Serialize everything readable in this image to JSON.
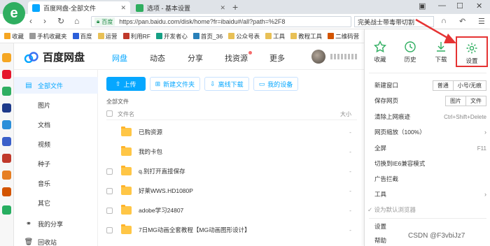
{
  "browser": {
    "logo_letter": "e",
    "tabs": [
      {
        "label": "百度网盘-全部文件",
        "active": true
      },
      {
        "label": "选项 - 基本设置",
        "active": false
      }
    ],
    "new_tab": "+",
    "url": {
      "badge": "百度",
      "text": "https://pan.baidu.com/disk/home?fr=ibaidu#/all?path=%2F8"
    },
    "search_text": "完美战士带毒带切割"
  },
  "bookmarks": [
    "收藏",
    "手机收藏夹",
    "百度",
    "运营",
    "利用RF",
    "开发者心",
    "首页_36",
    "公众号表",
    "工具",
    "教程工具",
    "二维码营"
  ],
  "baidu": {
    "logo": "百度网盘",
    "nav": [
      "网盘",
      "动态",
      "分享",
      "找资源",
      "更多"
    ],
    "sidebar": [
      {
        "label": "全部文件",
        "icon": "file-icon",
        "active": true
      },
      {
        "label": "图片"
      },
      {
        "label": "文档"
      },
      {
        "label": "视频"
      },
      {
        "label": "种子"
      },
      {
        "label": "音乐"
      },
      {
        "label": "其它"
      },
      {
        "label": "我的分享",
        "icon": "share-icon"
      },
      {
        "label": "回收站",
        "icon": "trash-icon"
      }
    ],
    "buttons": {
      "upload": "上传",
      "new_folder": "新建文件夹",
      "offline": "离线下载",
      "device": "我的设备"
    },
    "breadcrumb": "全部文件",
    "columns": {
      "name": "文件名",
      "size": "大小"
    },
    "files": [
      {
        "name": "已购资源",
        "size": "-",
        "checkbox": false
      },
      {
        "name": "我的卡包",
        "size": "-",
        "checkbox": false
      },
      {
        "name": "q.别打开直接保存",
        "size": "-",
        "checkbox": true
      },
      {
        "name": "好莱WWS.HD1080P",
        "size": "-",
        "checkbox": true
      },
      {
        "name": "adobe学习24807",
        "size": "-",
        "checkbox": true
      },
      {
        "name": "7日MG动画全套教程【MG动画图形设计】",
        "size": "-",
        "checkbox": true
      }
    ]
  },
  "menu": {
    "quick": [
      {
        "label": "收藏",
        "icon": "star-icon"
      },
      {
        "label": "历史",
        "icon": "clock-icon"
      },
      {
        "label": "下载",
        "icon": "download-icon"
      },
      {
        "label": "设置",
        "icon": "settings-icon"
      }
    ],
    "items": {
      "new_window": "新建窗口",
      "new_window_opts": [
        "普通",
        "小号/无痕"
      ],
      "save_page": "保存网页",
      "save_page_opts": [
        "图片",
        "文件"
      ],
      "clear_history": "清除上网痕迹",
      "clear_history_sc": "Ctrl+Shift+Delete",
      "zoom": "网页缩放（100%）",
      "fullscreen": "全屏",
      "fullscreen_sc": "F11",
      "ie6": "切换到IE6兼容模式",
      "adblock": "广告拦截",
      "tools": "工具",
      "default_browser": "✓ 设为默认浏览器",
      "settings": "设置",
      "help": "帮助"
    }
  },
  "watermark": "CSDN @F3vbiJz7"
}
